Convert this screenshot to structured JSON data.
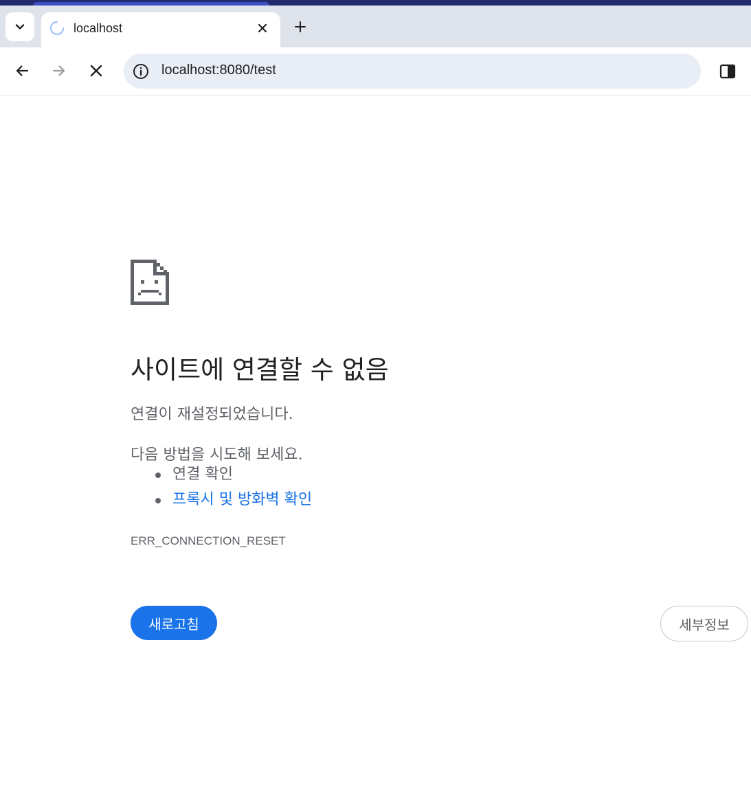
{
  "browser": {
    "tab": {
      "title": "localhost",
      "loading_icon": "spinner-icon"
    },
    "address_bar": {
      "url": "localhost:8080/test"
    },
    "icons": {
      "tab_search": "chevron-down-icon",
      "close_tab": "close-icon",
      "new_tab": "plus-icon",
      "back": "arrow-left-icon",
      "forward": "arrow-right-icon",
      "stop": "close-icon",
      "site_info": "info-icon",
      "side_panel": "side-panel-icon"
    }
  },
  "error_page": {
    "icon": "sad-document-icon",
    "title": "사이트에 연결할 수 없음",
    "description": "연결이 재설정되었습니다.",
    "suggestions_heading": "다음 방법을 시도해 보세요.",
    "suggestions": [
      {
        "label": "연결 확인",
        "is_link": false
      },
      {
        "label": "프록시 및 방화벽 확인",
        "is_link": true
      }
    ],
    "error_code": "ERR_CONNECTION_RESET",
    "reload_label": "새로고침",
    "details_label": "세부정보"
  },
  "colors": {
    "accent": "#1a73e8",
    "text_primary": "#202124",
    "text_secondary": "#5f6368",
    "tabbar": "#dfe3ec",
    "omnibox": "#e9edf6"
  }
}
